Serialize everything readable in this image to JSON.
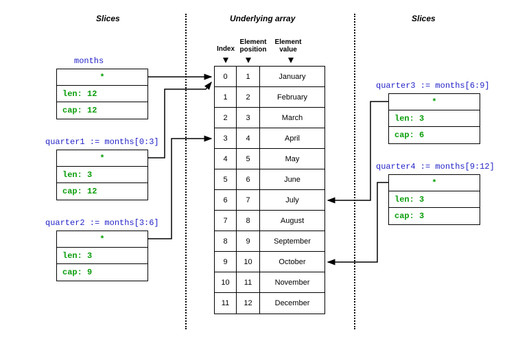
{
  "headings": {
    "left": "Slices",
    "center": "Underlying array",
    "right": "Slices"
  },
  "columns": {
    "index": "Index",
    "position": "Element\nposition",
    "value": "Element\nvalue"
  },
  "slices": {
    "months": {
      "label": "months",
      "ptr": "*",
      "len": "len: 12",
      "cap": "cap: 12"
    },
    "q1": {
      "label": "quarter1 := months[0:3]",
      "ptr": "*",
      "len": "len: 3",
      "cap": "cap: 12"
    },
    "q2": {
      "label": "quarter2 := months[3:6]",
      "ptr": "*",
      "len": "len: 3",
      "cap": "cap: 9"
    },
    "q3": {
      "label": "quarter3 := months[6:9]",
      "ptr": "*",
      "len": "len: 3",
      "cap": "cap: 6"
    },
    "q4": {
      "label": "quarter4 := months[9:12]",
      "ptr": "*",
      "len": "len: 3",
      "cap": "cap: 3"
    }
  },
  "array": [
    {
      "idx": "0",
      "pos": "1",
      "val": "January"
    },
    {
      "idx": "1",
      "pos": "2",
      "val": "February"
    },
    {
      "idx": "2",
      "pos": "3",
      "val": "March"
    },
    {
      "idx": "3",
      "pos": "4",
      "val": "April"
    },
    {
      "idx": "4",
      "pos": "5",
      "val": "May"
    },
    {
      "idx": "5",
      "pos": "6",
      "val": "June"
    },
    {
      "idx": "6",
      "pos": "7",
      "val": "July"
    },
    {
      "idx": "7",
      "pos": "8",
      "val": "August"
    },
    {
      "idx": "8",
      "pos": "9",
      "val": "September"
    },
    {
      "idx": "9",
      "pos": "10",
      "val": "October"
    },
    {
      "idx": "10",
      "pos": "11",
      "val": "November"
    },
    {
      "idx": "11",
      "pos": "12",
      "val": "December"
    }
  ]
}
